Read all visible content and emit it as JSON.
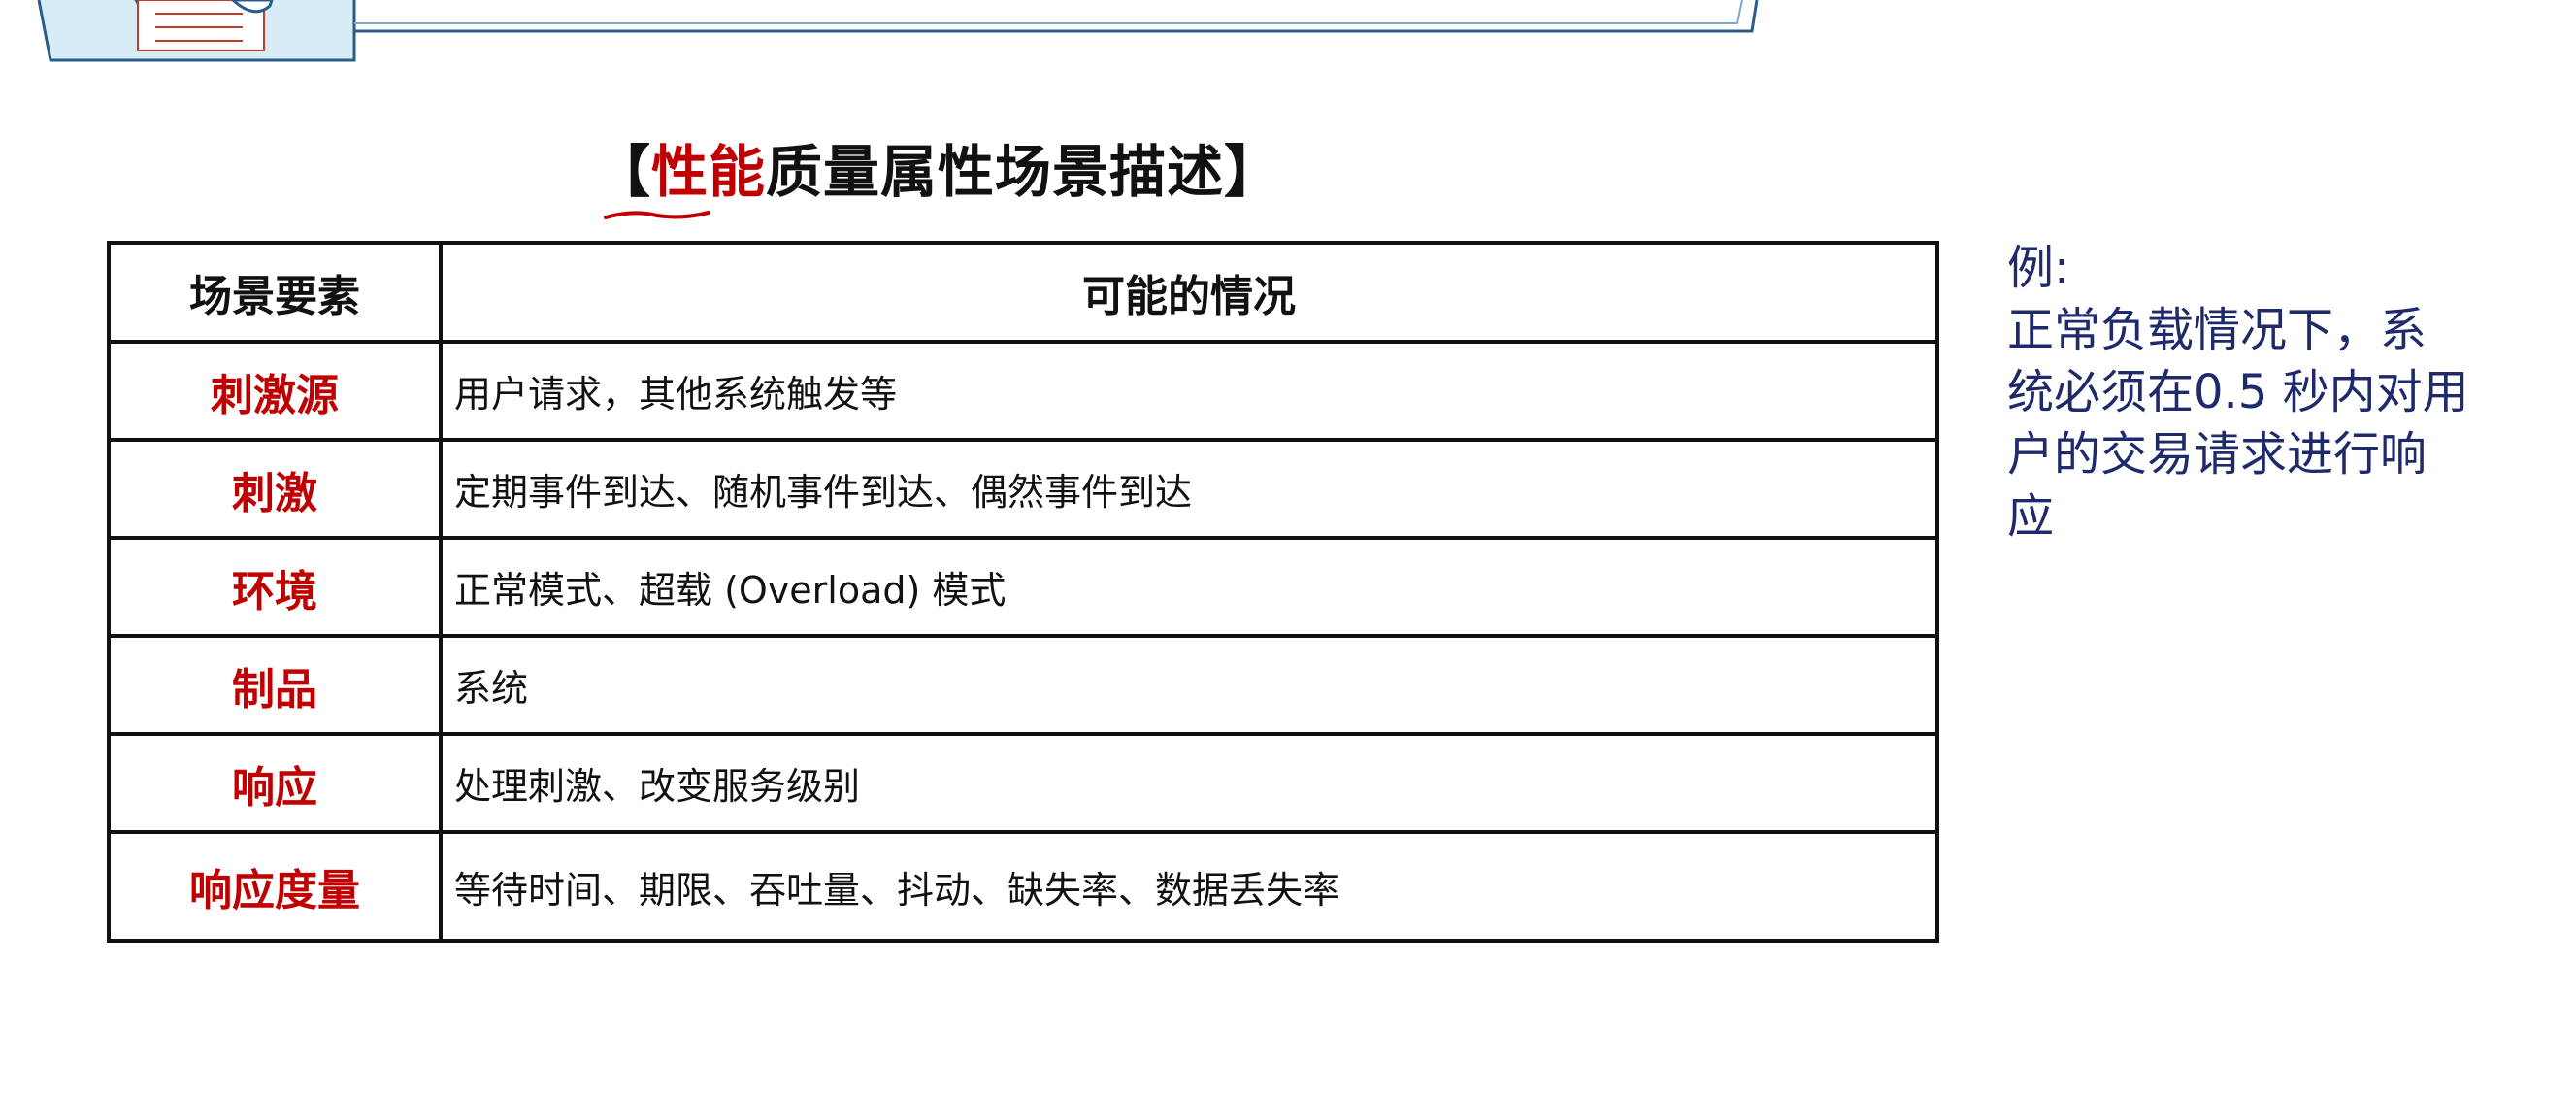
{
  "title": {
    "bracket_open": "【",
    "accent": "性能",
    "rest": "质量属性场景描述",
    "bracket_close": "】"
  },
  "table": {
    "headers": [
      "场景要素",
      "可能的情况"
    ],
    "rows": [
      {
        "element": "刺激源",
        "value": "用户请求，其他系统触发等"
      },
      {
        "element": "刺激",
        "value": "定期事件到达、随机事件到达、偶然事件到达"
      },
      {
        "element": "环境",
        "value": "正常模式、超载 (Overload) 模式"
      },
      {
        "element": "制品",
        "value": "系统"
      },
      {
        "element": "响应",
        "value": "处理刺激、改变服务级别"
      },
      {
        "element": "响应度量",
        "value": "等待时间、期限、吞吐量、抖动、缺失率、数据丢失率"
      }
    ]
  },
  "example": {
    "lines": [
      "例:",
      "正常负载情况下，系",
      "统必须在0.5 秒内对用",
      "户的交易请求进行响",
      "应"
    ]
  },
  "colors": {
    "accent": "#c00000",
    "example_text": "#1f2a6b",
    "table_border": "#111111"
  }
}
